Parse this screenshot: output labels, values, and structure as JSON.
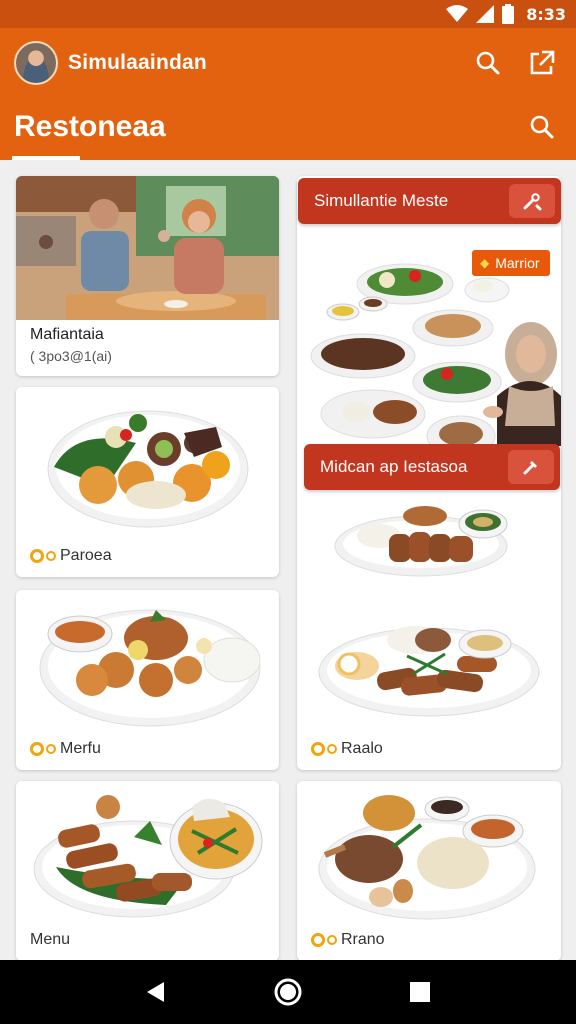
{
  "status_bar": {
    "time": "8:33"
  },
  "app_bar": {
    "app_name": "Simulaaindan",
    "title": "Restoneaa"
  },
  "cards": {
    "c1": {
      "title": "Mafiantaia",
      "subtitle": "( 3po3@1(ai)"
    },
    "c2": {
      "label": "Paroea"
    },
    "c3": {
      "label": "Merfu"
    },
    "c4": {
      "label": "Menu"
    },
    "c5": {
      "label": "Raalo"
    },
    "c6": {
      "label": "Rrano"
    }
  },
  "banners": {
    "b1": {
      "text": "Simullantie Meste"
    },
    "b2": {
      "text": "Midcan ap Iestasoa"
    }
  },
  "chip": {
    "label": "Marrior"
  },
  "colors": {
    "status_bar": "#c9500f",
    "app_bar": "#e2620f",
    "banner": "#c2361f",
    "chip": "#e8590c",
    "accent_dot": "#f2a40b"
  },
  "icons": {
    "app_bar": [
      "search-icon",
      "share-icon",
      "search-icon"
    ],
    "nav": [
      "back-icon",
      "home-icon",
      "recents-icon"
    ]
  }
}
